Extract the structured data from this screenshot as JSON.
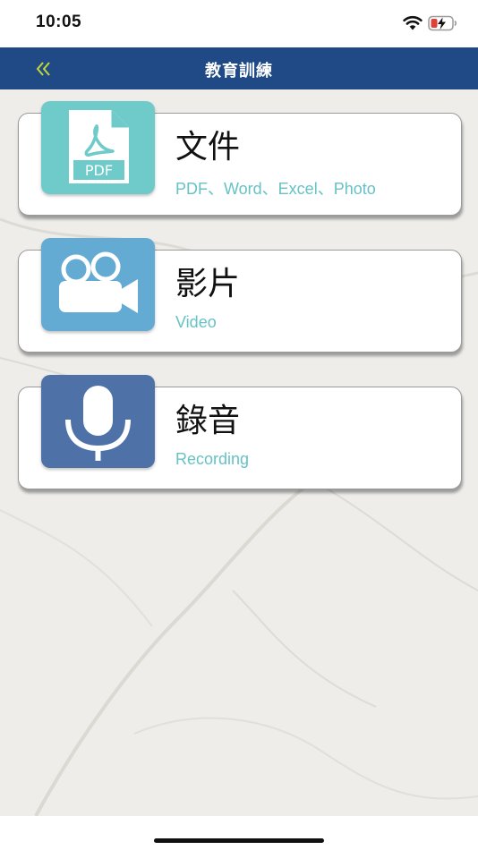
{
  "status_bar": {
    "time": "10:05",
    "wifi_icon": "wifi-icon",
    "battery_icon": "battery-charging-icon",
    "battery_color": "#e0403a"
  },
  "nav": {
    "title": "教育訓練",
    "back_icon": "double-chevron-left-icon",
    "background_color": "#1f4a86",
    "back_icon_color": "#c4d63b"
  },
  "cards": [
    {
      "id": "documents",
      "title": "文件",
      "subtitle": "PDF、Word、Excel、Photo",
      "icon": "pdf-document-icon",
      "icon_text": "PDF",
      "icon_color": "#6fcbc9"
    },
    {
      "id": "video",
      "title": "影片",
      "subtitle": "Video",
      "icon": "video-camera-icon",
      "icon_color": "#63abd3"
    },
    {
      "id": "recording",
      "title": "錄音",
      "subtitle": "Recording",
      "icon": "microphone-icon",
      "icon_color": "#4e71a8"
    }
  ],
  "colors": {
    "subtitle": "#66c2c4",
    "card_background": "#ffffff"
  }
}
